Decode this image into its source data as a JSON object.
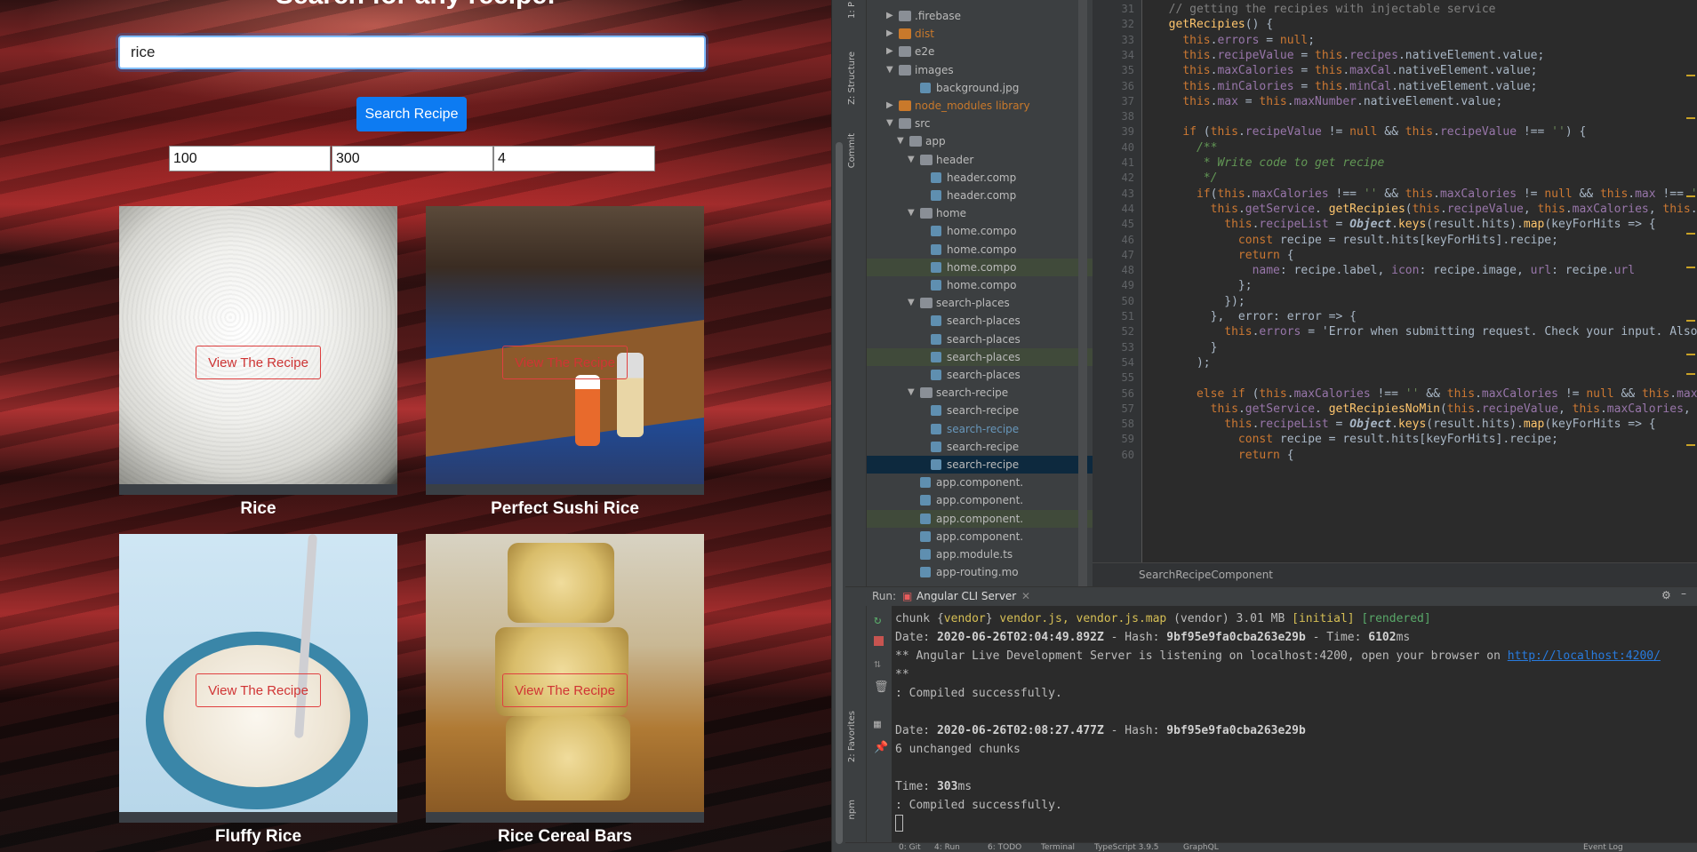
{
  "browser": {
    "heading": "Search for any recipe!",
    "search_value": "rice",
    "search_button": "Search Recipe",
    "min_calories": "100",
    "max_calories": "300",
    "max_number": "4",
    "recipes": [
      {
        "title": "Rice",
        "button": "View The Recipe"
      },
      {
        "title": "Perfect Sushi Rice",
        "button": "View The Recipe"
      },
      {
        "title": "Fluffy Rice",
        "button": "View The Recipe"
      },
      {
        "title": "Rice Cereal Bars",
        "button": "View The Recipe"
      }
    ]
  },
  "ide": {
    "side_tabs": [
      "1: P",
      "Z: Structure",
      "Commit",
      "2: Favorites",
      "npm"
    ],
    "tree": [
      {
        "label": ".firebase",
        "type": "folder"
      },
      {
        "label": "dist",
        "type": "folder-orange"
      },
      {
        "label": "e2e",
        "type": "folder"
      },
      {
        "label": "images",
        "type": "folder"
      },
      {
        "label": "background.jpg",
        "type": "file"
      },
      {
        "label": "node_modules  library",
        "type": "folder-orange"
      },
      {
        "label": "src",
        "type": "folder"
      },
      {
        "label": "app",
        "type": "folder"
      },
      {
        "label": "header",
        "type": "folder"
      },
      {
        "label": "header.comp",
        "type": "file"
      },
      {
        "label": "header.comp",
        "type": "file"
      },
      {
        "label": "home",
        "type": "folder"
      },
      {
        "label": "home.compo",
        "type": "file"
      },
      {
        "label": "home.compo",
        "type": "file"
      },
      {
        "label": "home.compo",
        "type": "file"
      },
      {
        "label": "home.compo",
        "type": "file"
      },
      {
        "label": "search-places",
        "type": "folder"
      },
      {
        "label": "search-places",
        "type": "file"
      },
      {
        "label": "search-places",
        "type": "file"
      },
      {
        "label": "search-places",
        "type": "file"
      },
      {
        "label": "search-places",
        "type": "file"
      },
      {
        "label": "search-recipe",
        "type": "folder"
      },
      {
        "label": "search-recipe",
        "type": "file"
      },
      {
        "label": "search-recipe",
        "type": "file"
      },
      {
        "label": "search-recipe",
        "type": "file"
      },
      {
        "label": "search-recipe",
        "type": "file"
      },
      {
        "label": "app.component.",
        "type": "file"
      },
      {
        "label": "app.component.",
        "type": "file"
      },
      {
        "label": "app.component.",
        "type": "file"
      },
      {
        "label": "app.component.",
        "type": "file"
      },
      {
        "label": "app.module.ts",
        "type": "file"
      },
      {
        "label": "app-routing.mo",
        "type": "file"
      }
    ],
    "line_numbers": [
      "31",
      "32",
      "33",
      "34",
      "35",
      "36",
      "37",
      "38",
      "39",
      "40",
      "41",
      "42",
      "43",
      "44",
      "45",
      "46",
      "47",
      "48",
      "49",
      "50",
      "51",
      "52",
      "53",
      "54",
      "55",
      "56",
      "57",
      "58",
      "59",
      "60"
    ],
    "code_lines": [
      "  // getting the recipies with injectable service",
      "  getRecipies() {",
      "    this.errors = null;",
      "    this.recipeValue = this.recipes.nativeElement.value;",
      "    this.maxCalories = this.maxCal.nativeElement.value;",
      "    this.minCalories = this.minCal.nativeElement.value;",
      "    this.max = this.maxNumber.nativeElement.value;",
      "",
      "    if (this.recipeValue != null && this.recipeValue !== '') {",
      "      /**",
      "       * Write code to get recipe",
      "       */",
      "      if(this.maxCalories !== '' && this.maxCalories != null && this.max !== '' && th",
      "        this.getService. getRecipies(this.recipeValue, this.maxCalories, this.minCalo",
      "          this.recipeList = Object.keys(result.hits).map(keyForHits => {",
      "            const recipe = result.hits[keyForHits].recipe;",
      "            return {",
      "              name: recipe.label, icon: recipe.image, url: recipe.url",
      "            };",
      "          });",
      "        },  error: error => {",
      "          this.errors = 'Error when submitting request. Check your input. Also, you",
      "        }",
      "      );",
      "",
      "      else if (this.maxCalories !== '' && this.maxCalories != null && this.max !== '",
      "        this.getService. getRecipiesNoMin(this.recipeValue, this.maxCalories, this.max",
      "          this.recipeList = Object.keys(result.hits).map(keyForHits => {",
      "            const recipe = result.hits[keyForHits].recipe;",
      "            return {"
    ],
    "breadcrumb": "SearchRecipeComponent",
    "run_label": "Run:",
    "run_tab": "Angular CLI Server",
    "console": {
      "l1_a": "chunk {",
      "l1_b": "vendor",
      "l1_c": "} ",
      "l1_d": "vendor.js, vendor.js.map",
      "l1_e": " (vendor) 3.01 MB ",
      "l1_f": "[initial]",
      "l1_g": " [rendered]",
      "l2_a": "Date: ",
      "l2_b": "2020-06-26T02:04:49.892Z",
      "l2_c": " - Hash: ",
      "l2_d": "9bf95e9fa0cba263e29b",
      "l2_e": " - Time: ",
      "l2_f": "6102",
      "l2_g": "ms",
      "l3_a": "** Angular Live Development Server is listening on localhost:4200, open your browser on ",
      "l3_b": "http://localhost:4200/",
      "l4": "**",
      "l5": ": Compiled successfully.",
      "l6": "",
      "l7_a": "Date: ",
      "l7_b": "2020-06-26T02:08:27.477Z",
      "l7_c": " - Hash: ",
      "l7_d": "9bf95e9fa0cba263e29b",
      "l8": "6 unchanged chunks",
      "l9": "",
      "l10_a": "Time: ",
      "l10_b": "303",
      "l10_c": "ms",
      "l11": ": Compiled successfully."
    },
    "status_items": [
      "0: Git",
      "4: Run",
      "6: TODO",
      "Terminal",
      "TypeScript 3.9.5",
      "GraphQL",
      "Event Log"
    ]
  }
}
